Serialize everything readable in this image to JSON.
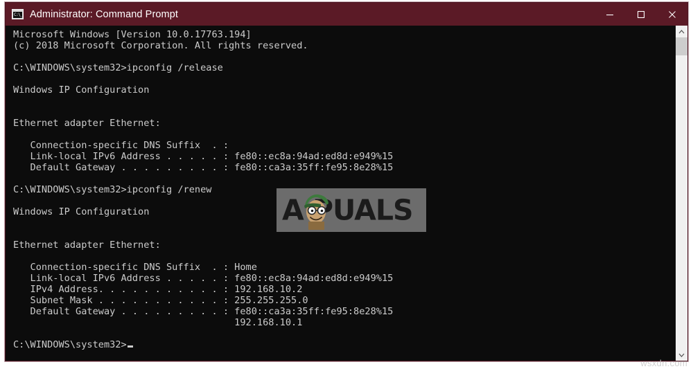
{
  "window": {
    "title": "Administrator: Command Prompt",
    "icon_name": "command-prompt-icon",
    "icon_glyph": "C:\\_",
    "colors": {
      "titlebar": "#5b1a26",
      "console_bg": "#0c0c0c",
      "console_fg": "#cccccc",
      "border": "#4a1320",
      "scrollbar_track": "#f0f0f0",
      "scrollbar_thumb": "#cdcdcd"
    },
    "controls": {
      "minimize": "Minimize",
      "maximize": "Maximize",
      "close": "Close"
    }
  },
  "console": {
    "lines": [
      "Microsoft Windows [Version 10.0.17763.194]",
      "(c) 2018 Microsoft Corporation. All rights reserved.",
      "",
      "C:\\WINDOWS\\system32>ipconfig /release",
      "",
      "Windows IP Configuration",
      "",
      "",
      "Ethernet adapter Ethernet:",
      "",
      "   Connection-specific DNS Suffix  . :",
      "   Link-local IPv6 Address . . . . . : fe80::ec8a:94ad:ed8d:e949%15",
      "   Default Gateway . . . . . . . . . : fe80::ca3a:35ff:fe95:8e28%15",
      "",
      "C:\\WINDOWS\\system32>ipconfig /renew",
      "",
      "Windows IP Configuration",
      "",
      "",
      "Ethernet adapter Ethernet:",
      "",
      "   Connection-specific DNS Suffix  . : Home",
      "   Link-local IPv6 Address . . . . . : fe80::ec8a:94ad:ed8d:e949%15",
      "   IPv4 Address. . . . . . . . . . . : 192.168.10.2",
      "   Subnet Mask . . . . . . . . . . . : 255.255.255.0",
      "   Default Gateway . . . . . . . . . : fe80::ca3a:35ff:fe95:8e28%15",
      "                                       192.168.10.1",
      "",
      "C:\\WINDOWS\\system32>"
    ],
    "prompt": "C:\\WINDOWS\\system32>",
    "commands": [
      "ipconfig /release",
      "ipconfig /renew"
    ],
    "network": {
      "adapter": "Ethernet adapter Ethernet:",
      "dns_suffix": "Home",
      "link_local_ipv6": "fe80::ec8a:94ad:ed8d:e949%15",
      "ipv4_address": "192.168.10.2",
      "subnet_mask": "255.255.255.0",
      "default_gateway_ipv6": "fe80::ca3a:35ff:fe95:8e28%15",
      "default_gateway_ipv4": "192.168.10.1"
    }
  },
  "scrollbar": {
    "up_arrow": "▲",
    "down_arrow": "▼",
    "thumb_position_percent": 0
  },
  "watermarks": {
    "appuals": "APPUALS",
    "appuals_visible_text": "A PUALS",
    "site": "wsxdn.com"
  }
}
